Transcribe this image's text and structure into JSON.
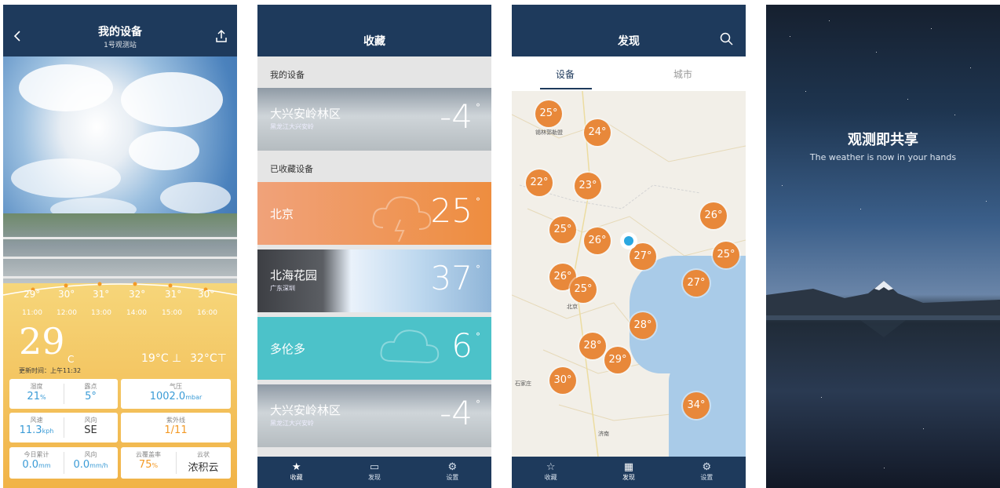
{
  "screen1": {
    "title": "我的设备",
    "subtitle": "1号观测站",
    "hourly": [
      {
        "temp": "29°",
        "time": "11:00"
      },
      {
        "temp": "30°",
        "time": "12:00"
      },
      {
        "temp": "31°",
        "time": "13:00"
      },
      {
        "temp": "32°",
        "time": "14:00"
      },
      {
        "temp": "31°",
        "time": "15:00"
      },
      {
        "temp": "30°",
        "time": "16:00"
      }
    ],
    "current_temp": "29",
    "current_unit": "C",
    "low": "19°C",
    "low_sym": "⊥",
    "high": "32°C",
    "high_sym": "⊤",
    "updated": "更新时间：上午11:32",
    "humidity_label": "湿度",
    "humidity_value": "21",
    "humidity_unit": "%",
    "dew_label": "露点",
    "dew_value": "5°",
    "pressure_label": "气压",
    "pressure_value": "1002.0",
    "pressure_unit": "mbar",
    "wind_speed_label": "风速",
    "wind_speed_value": "11.3",
    "wind_speed_unit": "kph",
    "wind_dir_label": "风向",
    "wind_dir_value": "SE",
    "uv_label": "紫外线",
    "uv_value": "1/11",
    "rain_today_label": "今日累计",
    "rain_today_value": "0.0",
    "rain_today_unit": "mm",
    "rain_rate_label": "风向",
    "rain_rate_value": "0.0",
    "rain_rate_unit": "mm/h",
    "cloud_label": "云覆盖率",
    "cloud_value": "75",
    "cloud_unit": "%",
    "cloud_type_label": "云状",
    "cloud_type_value": "浓积云"
  },
  "screen2": {
    "title": "收藏",
    "section_mine": "我的设备",
    "section_fav": "已收藏设备",
    "items": [
      {
        "name": "大兴安岭林区",
        "place": "黑龙江大兴安岭",
        "temp": "-4",
        "deg": "°"
      },
      {
        "name": "北京",
        "place": "",
        "temp": "25",
        "deg": "°"
      },
      {
        "name": "北海花园",
        "place": "广东深圳",
        "temp": "37",
        "deg": "°"
      },
      {
        "name": "多伦多",
        "place": "",
        "temp": "6",
        "deg": "°"
      },
      {
        "name": "大兴安岭林区",
        "place": "黑龙江大兴安岭",
        "temp": "-4",
        "deg": "°"
      }
    ],
    "tabs": [
      "收藏",
      "发现",
      "设置"
    ]
  },
  "screen3": {
    "title": "发现",
    "seg_devices": "设备",
    "seg_cities": "城市",
    "pins": [
      "25°",
      "24°",
      "22°",
      "23°",
      "25°",
      "26°",
      "26°",
      "27°",
      "25°",
      "26°",
      "25°",
      "27°",
      "28°",
      "28°",
      "29°",
      "30°",
      "34°"
    ],
    "city_labels": [
      "锡林郭勒盟",
      "北京",
      "石家庄",
      "济南"
    ],
    "tabs": [
      "收藏",
      "发现",
      "设置"
    ]
  },
  "screen4": {
    "slogan": "观测即共享",
    "slogan_en": "The weather is now in your hands"
  },
  "colors": {
    "navy": "#1e3a5c",
    "orange": "#f39a26",
    "blue": "#3a9bd6"
  }
}
